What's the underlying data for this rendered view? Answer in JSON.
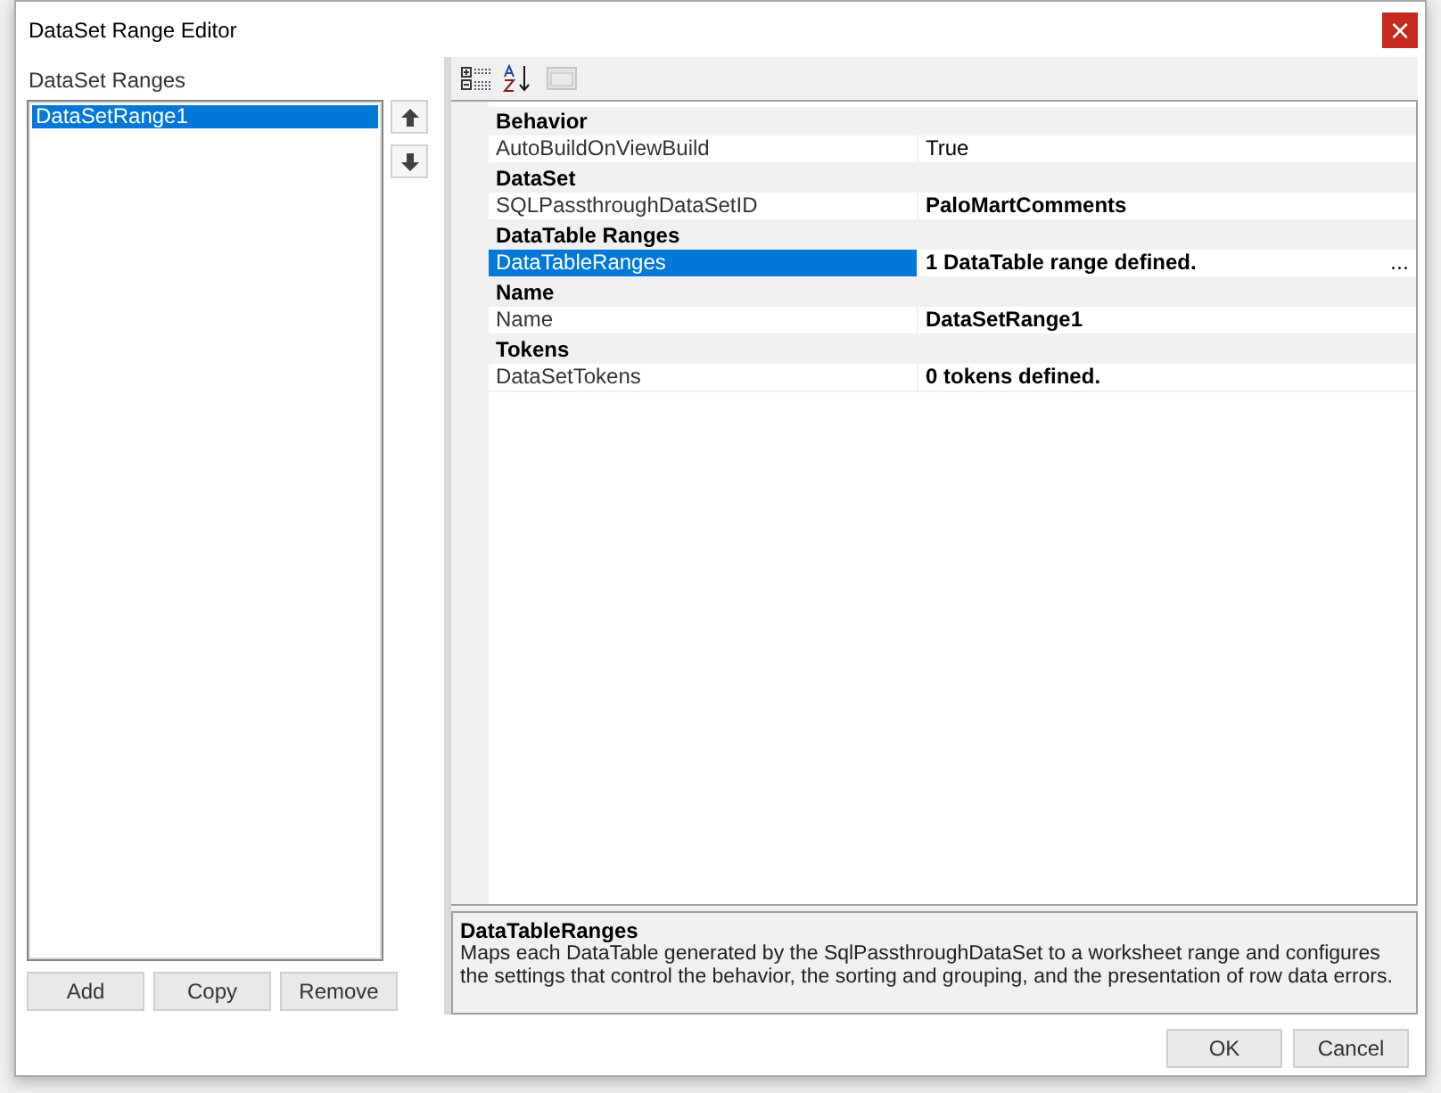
{
  "window": {
    "title": "DataSet Range Editor",
    "close": "×"
  },
  "ranges": {
    "label": "DataSet Ranges",
    "items": [
      {
        "text": "DataSetRange1",
        "selected": true
      }
    ],
    "buttons": [
      "Add",
      "Copy",
      "Remove"
    ]
  },
  "property_grid": {
    "toolbar": [
      {
        "kind": "categorized",
        "selected": false
      },
      {
        "kind": "alphabetical",
        "selected": false
      },
      {
        "kind": "pages",
        "disabled": true
      }
    ],
    "categories": [
      {
        "name": "Behavior",
        "properties": [
          {
            "name": "AutoBuildOnViewBuild",
            "value": "True",
            "bold": false,
            "selected": false
          }
        ]
      },
      {
        "name": "DataSet",
        "properties": [
          {
            "name": "SQLPassthroughDataSetID",
            "value": "PaloMartComments",
            "bold": true,
            "selected": false
          }
        ]
      },
      {
        "name": "DataTable Ranges",
        "properties": [
          {
            "name": "DataTableRanges",
            "value": "1 DataTable range defined.",
            "bold": true,
            "selected": true,
            "ellipsis": "..."
          }
        ]
      },
      {
        "name": "Name",
        "properties": [
          {
            "name": "Name",
            "value": "DataSetRange1",
            "bold": true,
            "selected": false
          }
        ]
      },
      {
        "name": "Tokens",
        "properties": [
          {
            "name": "DataSetTokens",
            "value": "0 tokens defined.",
            "bold": true,
            "selected": false
          }
        ]
      }
    ],
    "description": {
      "title": "DataTableRanges",
      "text": "Maps each DataTable generated by the SqlPassthroughDataSet to a worksheet range and configures the settings that control the behavior, the sorting and grouping, and the presentation of row data errors."
    }
  },
  "buttons": [
    "OK",
    "Cancel"
  ]
}
